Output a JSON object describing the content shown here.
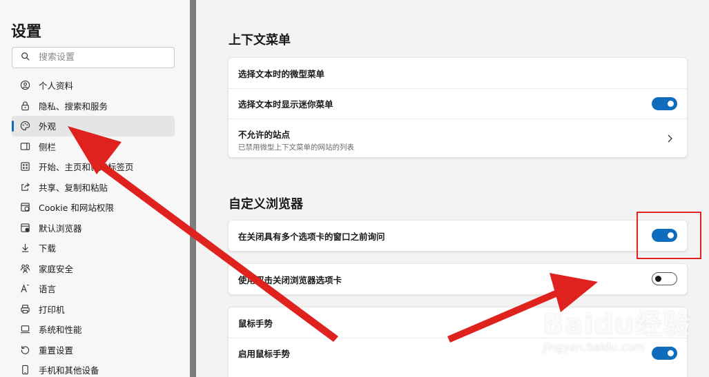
{
  "sidebar": {
    "title": "设置",
    "search_placeholder": "搜索设置",
    "items": [
      {
        "label": "个人资料",
        "icon": "profile-icon"
      },
      {
        "label": "隐私、搜索和服务",
        "icon": "lock-icon"
      },
      {
        "label": "外观",
        "icon": "appearance-icon",
        "active": true
      },
      {
        "label": "侧栏",
        "icon": "sidebar-icon"
      },
      {
        "label": "开始、主页和新建标签页",
        "icon": "home-icon"
      },
      {
        "label": "共享、复制和粘贴",
        "icon": "share-icon"
      },
      {
        "label": "Cookie 和网站权限",
        "icon": "cookie-icon"
      },
      {
        "label": "默认浏览器",
        "icon": "browser-icon"
      },
      {
        "label": "下载",
        "icon": "download-icon"
      },
      {
        "label": "家庭安全",
        "icon": "family-icon"
      },
      {
        "label": "语言",
        "icon": "language-icon"
      },
      {
        "label": "打印机",
        "icon": "printer-icon"
      },
      {
        "label": "系统和性能",
        "icon": "laptop-icon"
      },
      {
        "label": "重置设置",
        "icon": "reset-icon"
      },
      {
        "label": "手机和其他设备",
        "icon": "phone-icon"
      }
    ]
  },
  "context_menu": {
    "title": "上下文菜单",
    "header": "选择文本时的微型菜单",
    "show_mini_menu": {
      "label": "选择文本时显示迷你菜单",
      "enabled": true
    },
    "disallowed_sites": {
      "label": "不允许的站点",
      "description": "已禁用微型上下文菜单的网站的列表"
    }
  },
  "customize": {
    "title": "自定义浏览器",
    "ask_before_close": {
      "label": "在关闭具有多个选项卡的窗口之前询问",
      "enabled": true
    },
    "double_click_close": {
      "label": "使用双击关闭浏览器选项卡",
      "enabled": false
    },
    "mouse_gestures_header": "鼠标手势",
    "enable_mouse_gestures": {
      "label": "启用鼠标手势",
      "enabled": true
    }
  },
  "watermark": {
    "brand": "Baidu经验",
    "url": "jingyan.baidu.com"
  },
  "colors": {
    "accent": "#0f6cbd",
    "annotation_red": "#e0221f"
  }
}
